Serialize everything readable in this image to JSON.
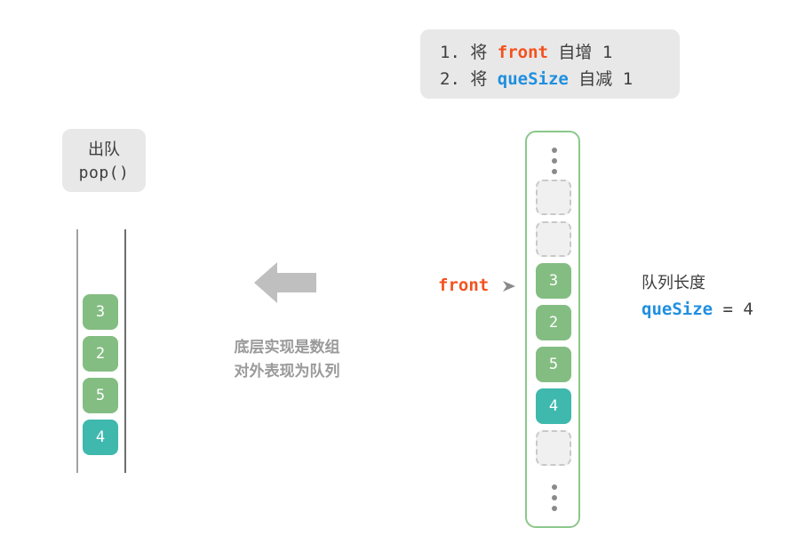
{
  "instruction": {
    "line1_prefix": "1. 将 ",
    "line1_keyword": "front",
    "line1_suffix": " 自增 1",
    "line2_prefix": "2. 将 ",
    "line2_keyword": "queSize",
    "line2_suffix": " 自减 1"
  },
  "pop_label": {
    "title": "出队",
    "method": "pop()"
  },
  "left_queue": {
    "cells": [
      {
        "value": "3",
        "style": "green"
      },
      {
        "value": "2",
        "style": "green"
      },
      {
        "value": "5",
        "style": "green"
      },
      {
        "value": "4",
        "style": "teal"
      }
    ]
  },
  "center": {
    "caption_line1": "底层实现是数组",
    "caption_line2": "对外表现为队列",
    "arrow_direction": "left"
  },
  "array_container": {
    "slots": [
      {
        "kind": "dots",
        "value": ""
      },
      {
        "kind": "empty",
        "value": ""
      },
      {
        "kind": "empty",
        "value": ""
      },
      {
        "kind": "green",
        "value": "3"
      },
      {
        "kind": "green",
        "value": "2"
      },
      {
        "kind": "green",
        "value": "5"
      },
      {
        "kind": "teal",
        "value": "4"
      },
      {
        "kind": "empty",
        "value": ""
      },
      {
        "kind": "dots",
        "value": ""
      }
    ]
  },
  "front_pointer": {
    "label": "front"
  },
  "quesize_note": {
    "title": "队列长度",
    "name": "queSize",
    "equals": " = ",
    "value": "4"
  },
  "colors": {
    "accent_front": "#f4511e",
    "accent_quesize": "#1f8fe0",
    "cell_green": "#84bd82",
    "cell_teal": "#3fb8ae",
    "note_bg": "#e8e8e8",
    "container_border": "#8bc78b",
    "caption_gray": "#9a9a9a",
    "arrow_gray": "#bfbfbf"
  }
}
